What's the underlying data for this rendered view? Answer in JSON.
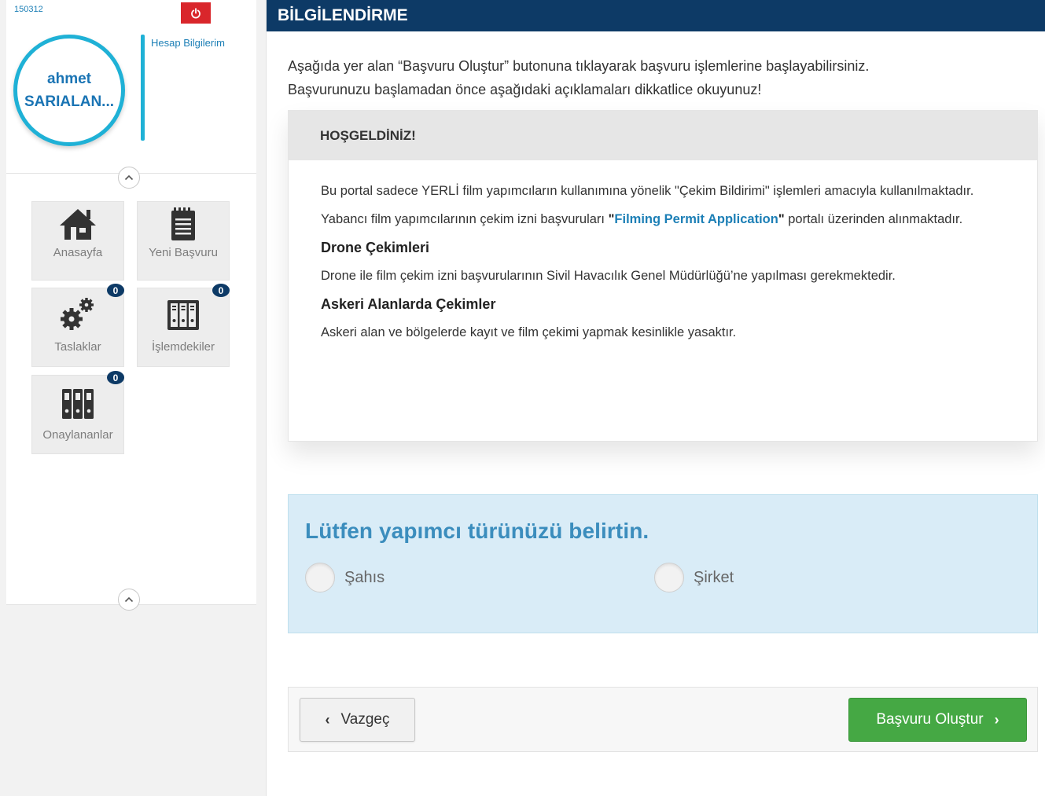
{
  "sidebar": {
    "user_code": "150312",
    "user": {
      "first_name": "ahmet",
      "last_name": "SARIALAN..."
    },
    "account_link": "Hesap Bilgilerim",
    "tiles": [
      {
        "label": "Anasayfa",
        "icon": "home-icon"
      },
      {
        "label": "Yeni Başvuru",
        "icon": "notepad-icon"
      },
      {
        "label": "Taslaklar",
        "icon": "gears-icon",
        "badge": "0"
      },
      {
        "label": "İşlemdekiler",
        "icon": "binders-icon",
        "badge": "0"
      },
      {
        "label": "Onaylananlar",
        "icon": "archive-icon",
        "badge": "0"
      }
    ]
  },
  "header": {
    "title": "BİLGİLENDİRME"
  },
  "intro": {
    "line1": "Aşağıda yer alan “Başvuru Oluştur” butonuna tıklayarak başvuru işlemlerine başlayabilirsiniz.",
    "line2": "Başvurunuzu başlamadan önce aşağıdaki açıklamaları dikkatlice okuyunuz!"
  },
  "info": {
    "title": "HOŞGELDİNİZ!",
    "p1": "Bu portal sadece YERLİ film yapımcıların kullanımına yönelik \"Çekim Bildirimi\" işlemleri amacıyla kullanılmaktadır.",
    "p2_before": "Yabancı film yapımcılarının çekim izni başvuruları ",
    "p2_link": "Filming Permit Application",
    "p2_after": " portalı üzerinden alınmaktadır.",
    "h_drone": "Drone Çekimleri",
    "p_drone": "Drone ile film çekim izni başvurularının Sivil Havacılık Genel Müdürlüğü’ne yapılması gerekmektedir.",
    "h_military": "Askeri Alanlarda Çekimler",
    "p_military": "Askeri alan ve bölgelerde kayıt ve film çekimi yapmak kesinlikle yasaktır."
  },
  "producer": {
    "title": "Lütfen yapımcı türünüzü belirtin.",
    "options": [
      "Şahıs",
      "Şirket"
    ]
  },
  "actions": {
    "cancel": "Vazgeç",
    "submit": "Başvuru Oluştur"
  },
  "colors": {
    "header": "#0d3a66",
    "accent": "#1fb1d6",
    "submit": "#45a844",
    "logout": "#d9262b"
  }
}
